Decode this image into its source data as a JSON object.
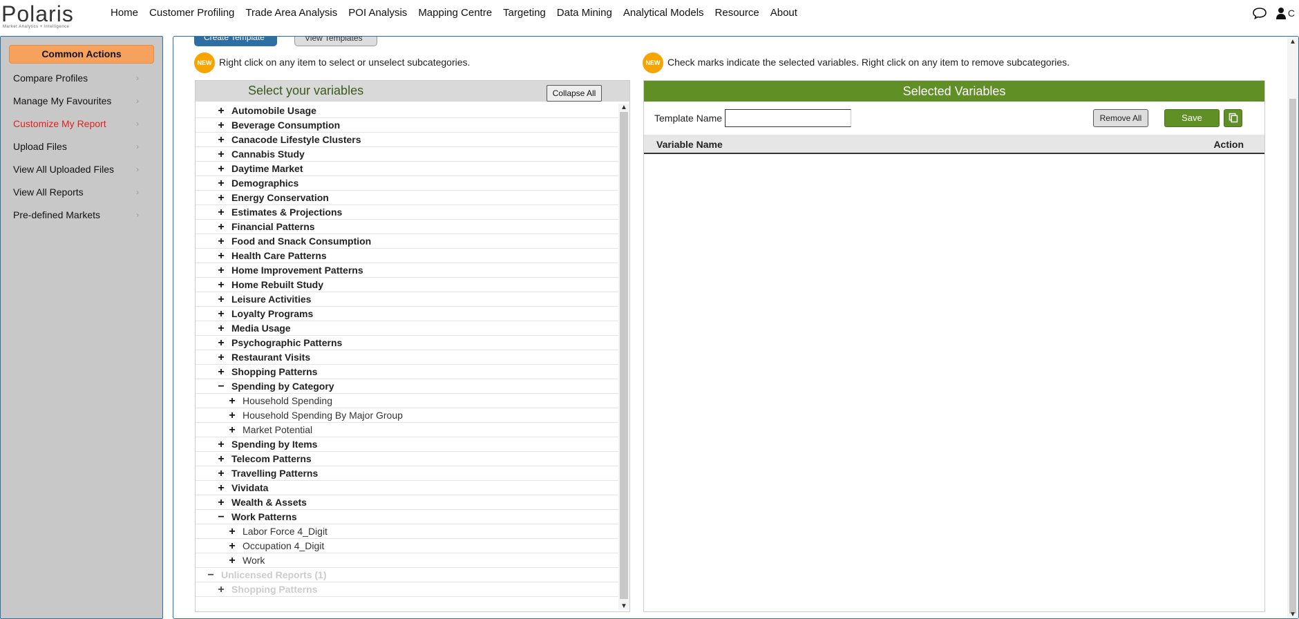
{
  "logo": {
    "main": "Polaris",
    "sub": "Market Analytics + Intelligence"
  },
  "nav": [
    "Home",
    "Customer Profiling",
    "Trade Area Analysis",
    "POI Analysis",
    "Mapping Centre",
    "Targeting",
    "Data Mining",
    "Analytical Models",
    "Resource",
    "About"
  ],
  "user": {
    "initial": "C"
  },
  "sidebar": {
    "header": "Common Actions",
    "items": [
      {
        "label": "Compare Profiles",
        "active": false
      },
      {
        "label": "Manage My Favourites",
        "active": false
      },
      {
        "label": "Customize My Report",
        "active": true
      },
      {
        "label": "Upload Files",
        "active": false
      },
      {
        "label": "View All Uploaded Files",
        "active": false
      },
      {
        "label": "View All Reports",
        "active": false
      },
      {
        "label": "Pre-defined Markets",
        "active": false
      }
    ],
    "chevron": "›"
  },
  "tabs": {
    "create": "Create Template",
    "view": "View Templates"
  },
  "badges": {
    "new": "NEW"
  },
  "hints": {
    "left": "Right click on any item to select or unselect subcategories.",
    "right": "Check marks indicate the selected variables. Right click on any item to remove subcategories."
  },
  "variables": {
    "title": "Select your variables",
    "collapse_all": "Collapse All",
    "tree": [
      {
        "label": "Automobile Usage",
        "level": 0,
        "toggle": "+"
      },
      {
        "label": "Beverage Consumption",
        "level": 0,
        "toggle": "+"
      },
      {
        "label": "Canacode Lifestyle Clusters",
        "level": 0,
        "toggle": "+"
      },
      {
        "label": "Cannabis Study",
        "level": 0,
        "toggle": "+"
      },
      {
        "label": "Daytime Market",
        "level": 0,
        "toggle": "+"
      },
      {
        "label": "Demographics",
        "level": 0,
        "toggle": "+"
      },
      {
        "label": "Energy Conservation",
        "level": 0,
        "toggle": "+"
      },
      {
        "label": "Estimates & Projections",
        "level": 0,
        "toggle": "+"
      },
      {
        "label": "Financial Patterns",
        "level": 0,
        "toggle": "+"
      },
      {
        "label": "Food and Snack Consumption",
        "level": 0,
        "toggle": "+"
      },
      {
        "label": "Health Care Patterns",
        "level": 0,
        "toggle": "+"
      },
      {
        "label": "Home Improvement Patterns",
        "level": 0,
        "toggle": "+"
      },
      {
        "label": "Home Rebuilt Study",
        "level": 0,
        "toggle": "+"
      },
      {
        "label": "Leisure Activities",
        "level": 0,
        "toggle": "+"
      },
      {
        "label": "Loyalty Programs",
        "level": 0,
        "toggle": "+"
      },
      {
        "label": "Media Usage",
        "level": 0,
        "toggle": "+"
      },
      {
        "label": "Psychographic Patterns",
        "level": 0,
        "toggle": "+"
      },
      {
        "label": "Restaurant Visits",
        "level": 0,
        "toggle": "+"
      },
      {
        "label": "Shopping Patterns",
        "level": 0,
        "toggle": "+"
      },
      {
        "label": "Spending by Category",
        "level": 0,
        "toggle": "−"
      },
      {
        "label": "Household Spending",
        "level": 1,
        "toggle": "+"
      },
      {
        "label": "Household Spending By Major Group",
        "level": 1,
        "toggle": "+"
      },
      {
        "label": "Market Potential",
        "level": 1,
        "toggle": "+"
      },
      {
        "label": "Spending by Items",
        "level": 0,
        "toggle": "+"
      },
      {
        "label": "Telecom Patterns",
        "level": 0,
        "toggle": "+"
      },
      {
        "label": "Travelling Patterns",
        "level": 0,
        "toggle": "+"
      },
      {
        "label": "Vividata",
        "level": 0,
        "toggle": "+"
      },
      {
        "label": "Wealth & Assets",
        "level": 0,
        "toggle": "+"
      },
      {
        "label": "Work Patterns",
        "level": 0,
        "toggle": "−"
      },
      {
        "label": "Labor Force 4_Digit",
        "level": 1,
        "toggle": "+"
      },
      {
        "label": "Occupation 4_Digit",
        "level": 1,
        "toggle": "+"
      },
      {
        "label": "Work",
        "level": 1,
        "toggle": "+"
      },
      {
        "label": "Unlicensed Reports (1)",
        "level": "u",
        "toggle": "−"
      },
      {
        "label": "Shopping Patterns",
        "level": "u2",
        "toggle": "+"
      }
    ]
  },
  "selected": {
    "title": "Selected Variables",
    "template_name_label": "Template Name",
    "template_name_value": "",
    "remove_all": "Remove All",
    "save": "Save",
    "columns": {
      "name": "Variable Name",
      "action": "Action"
    }
  },
  "colors": {
    "accent_blue": "#2c6e9e",
    "green": "#5f8f25",
    "orange": "#f6a15c",
    "active_red": "#e02020"
  }
}
